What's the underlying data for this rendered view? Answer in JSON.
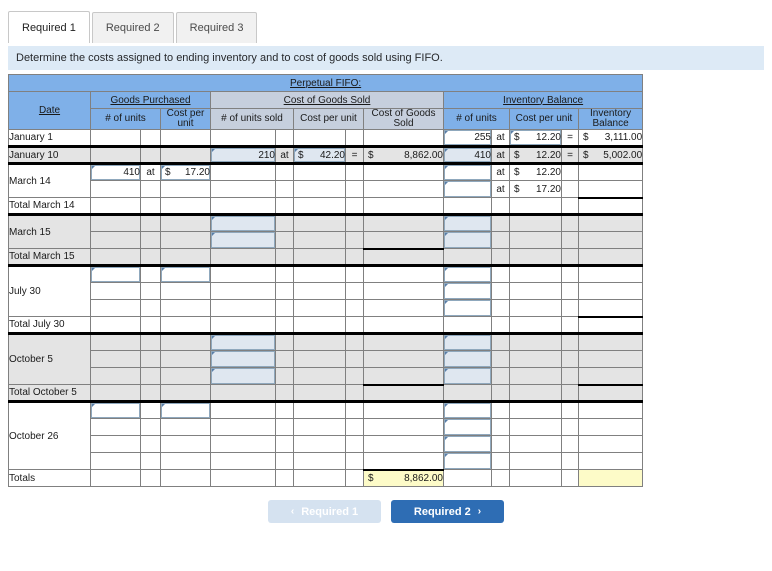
{
  "tabs": [
    {
      "label": "Required 1",
      "active": true
    },
    {
      "label": "Required 2",
      "active": false
    },
    {
      "label": "Required 3",
      "active": false
    }
  ],
  "instruction": "Determine the costs assigned to ending inventory and to cost of goods sold using FIFO.",
  "table": {
    "title": "Perpetual FIFO:",
    "groups": {
      "date": "Date",
      "goods_purchased": "Goods Purchased",
      "cogs": "Cost of Goods Sold",
      "inventory_balance": "Inventory Balance"
    },
    "subheaders": {
      "gp_units": "# of units",
      "gp_cost": "Cost per unit",
      "cogs_units": "# of units sold",
      "cogs_cost": "Cost per unit",
      "cogs_total": "Cost of Goods Sold",
      "ib_units": "# of units",
      "ib_cost": "Cost per unit",
      "ib_total": "Inventory Balance"
    },
    "at": "at",
    "eq": "=",
    "dollar": "$",
    "rows": {
      "jan1_label": "January 1",
      "jan1_ib_units": "255",
      "jan1_ib_cost": "12.20",
      "jan1_ib_total": "3,111.00",
      "jan10_label": "January 10",
      "jan10_cogs_units": "210",
      "jan10_cogs_cost": "42.20",
      "jan10_cogs_total": "8,862.00",
      "jan10_ib_units": "410",
      "jan10_ib_cost": "12.20",
      "jan10_ib_total": "5,002.00",
      "mar14_label": "March 14",
      "mar14_gp_units": "410",
      "mar14_gp_cost": "17.20",
      "mar14_ib_cost_1": "12.20",
      "mar14_ib_cost_2": "17.20",
      "total_mar14_label": "Total March 14",
      "mar15_label": "March 15",
      "total_mar15_label": "Total March 15",
      "jul30_label": "July 30",
      "total_jul30_label": "Total July 30",
      "oct5_label": "October 5",
      "total_oct5_label": "Total October 5",
      "oct26_label": "October 26",
      "totals_label": "Totals",
      "totals_cogs": "8,862.00"
    }
  },
  "nav": {
    "prev_label": "Required 1",
    "next_label": "Required 2",
    "prev_icon": "chevron-left-icon",
    "next_icon": "chevron-right-icon",
    "chev_left": "‹",
    "chev_right": "›"
  },
  "colors": {
    "header_blue": "#7fb0e8",
    "header_gray": "#c6cfdd",
    "instruction_bg": "#ddeaf6",
    "next_button": "#2e6db4",
    "prev_button": "#d5e2f0",
    "highlight_yellow": "#fdfbc8",
    "row_shade": "#e4e4e4"
  }
}
